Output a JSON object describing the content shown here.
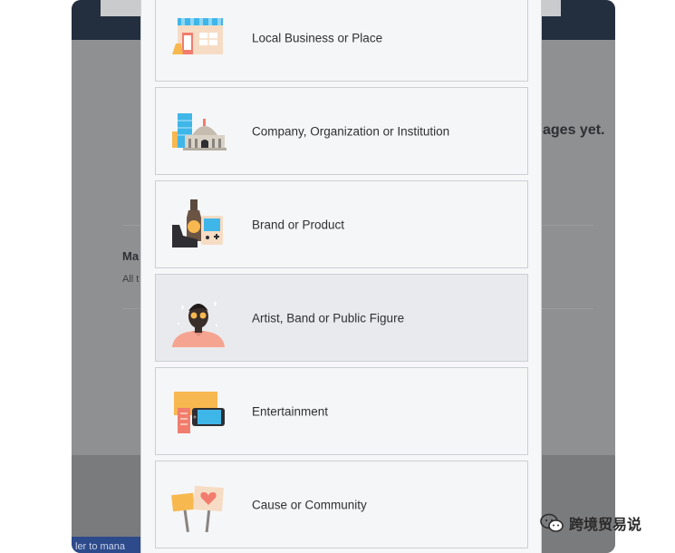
{
  "background": {
    "heading_fragment": "ages yet.",
    "section_label_fragment": "Ma",
    "section_sub_fragment": "All t",
    "bottom_link_fragment": "ler to mana"
  },
  "options": [
    {
      "label": "Local Business or Place",
      "icon": "storefront-icon"
    },
    {
      "label": "Company, Organization or Institution",
      "icon": "building-icon"
    },
    {
      "label": "Brand or Product",
      "icon": "product-icon"
    },
    {
      "label": "Artist, Band or Public Figure",
      "icon": "public-figure-icon",
      "hovered": true
    },
    {
      "label": "Entertainment",
      "icon": "entertainment-icon"
    },
    {
      "label": "Cause or Community",
      "icon": "community-sign-icon"
    }
  ],
  "watermark": {
    "text": "跨境贸易说",
    "icon": "wechat-icon"
  },
  "colors": {
    "modal_bg": "#f6f7f9",
    "option_border": "#cccfd3",
    "hover_bg": "#e9eaed",
    "overlay": "#8a8b8d"
  }
}
